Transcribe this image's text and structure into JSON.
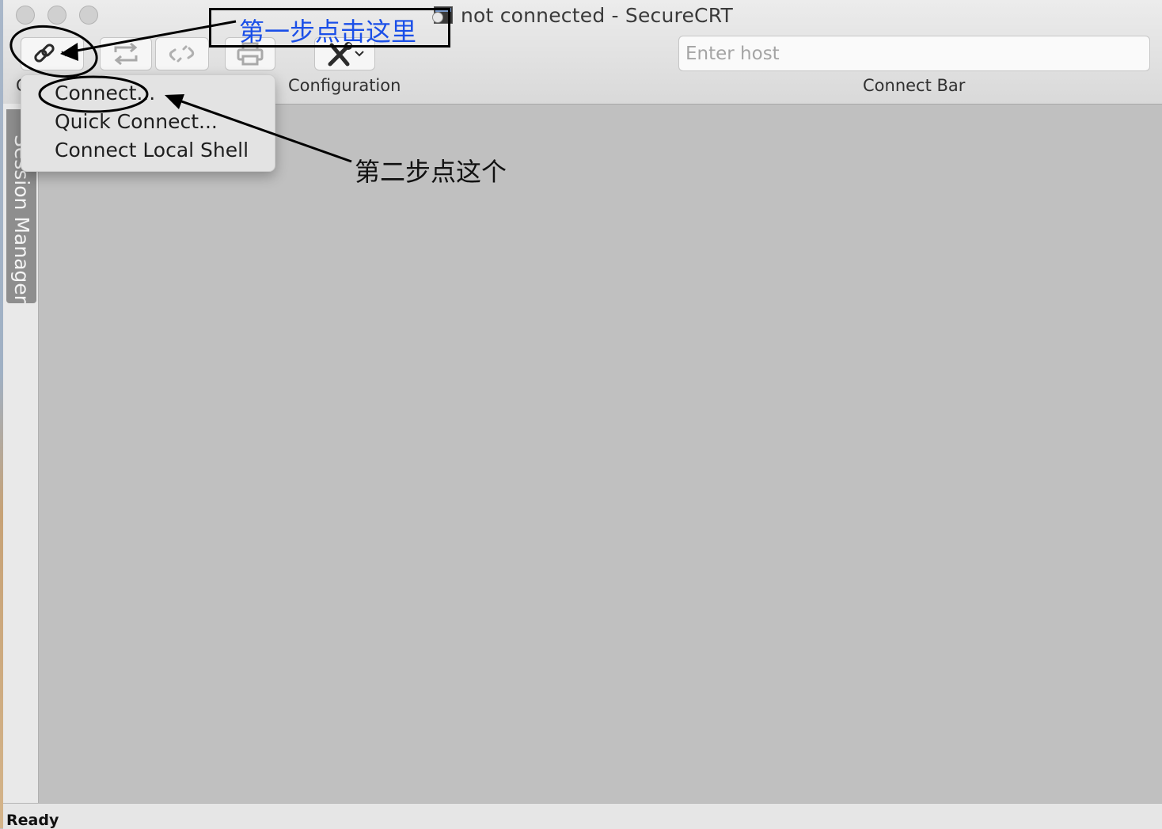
{
  "window": {
    "title": "not connected - SecureCRT"
  },
  "toolbar": {
    "connect_label": "C",
    "configuration_label": "Configuration",
    "connect_bar_label": "Connect Bar",
    "host_placeholder": "Enter host",
    "host_value": ""
  },
  "connect_menu": {
    "items": [
      "Connect...",
      "Quick Connect...",
      "Connect Local Shell"
    ]
  },
  "sidebar": {
    "session_manager_label": "Session Manager"
  },
  "status_bar": {
    "text": "Ready"
  },
  "annotations": {
    "step1": "第一步点击这里",
    "step2": "第二步点这个"
  },
  "colors": {
    "terminal_background": "#c0c0c0",
    "annotation_step1": "#1a4fe8",
    "annotation_ink": "#000000"
  },
  "icons": {
    "connect": "chain-link-icon",
    "reconnect": "reconnect-arrows-icon",
    "disconnect": "broken-link-icon",
    "print": "printer-icon",
    "configuration": "wrench-screwdriver-icon"
  }
}
